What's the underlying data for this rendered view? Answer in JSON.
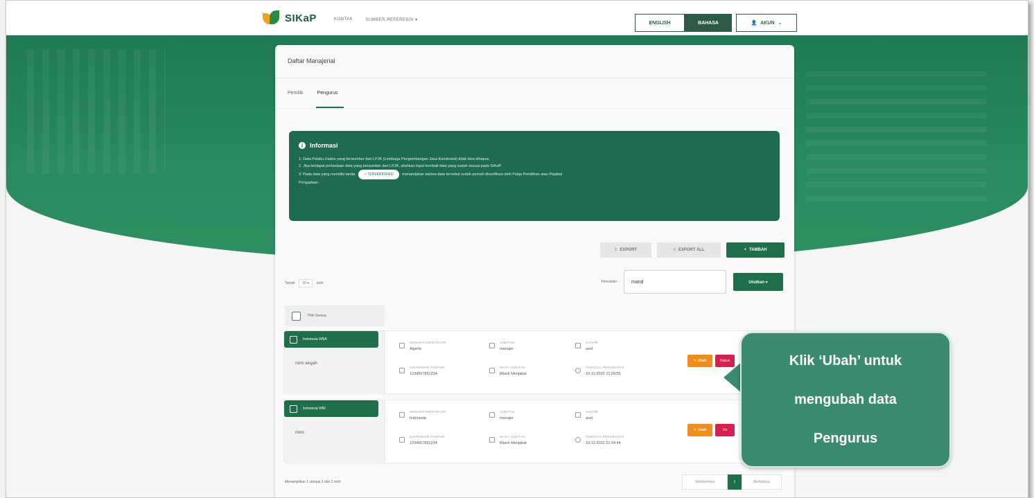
{
  "brand": {
    "logo_text": "SIKaP"
  },
  "nav": {
    "items": [
      "KONTAK",
      "SUMBER REFERENSI ▾"
    ]
  },
  "language": {
    "english": "ENGLISH",
    "bahasa": "BAHASA"
  },
  "account": {
    "label": "AKUN",
    "icon": "user-icon"
  },
  "page": {
    "title": "Daftar Manajerial",
    "tabs": [
      {
        "label": "Pemilik",
        "active": false
      },
      {
        "label": "Pengurus",
        "active": true
      }
    ]
  },
  "info": {
    "title": "Informasi",
    "lines": [
      "1. Data Pelaku Usaha yang bersumber dari LPJK (Lembaga Pengembangan Jasa Konstruksi) tidak bisa dihapus.",
      "2. Jika terdapat perbedaan data yang bersumber dari LPJK, silahkan input kembali data yang sudah sesuai pada SIKaP.",
      "3. Pada data yang memiliki tanda",
      "menandakan bahwa data tersebut sudah pernah diverifikasi oleh Pokja Pemilihan atau Pejabat",
      "Pengadaan."
    ],
    "verified_pill": "✓ TERVERIFIKASI"
  },
  "actions": {
    "export": "EXPORT",
    "export_all": "EXPORT ALL",
    "add": "TAMBAH"
  },
  "table_controls": {
    "show_prefix": "Tampil",
    "show_value": "10 ▾",
    "show_suffix": "entri",
    "search_label": "Pencarian",
    "search_value": "mand",
    "sort_label": "Urutkan ▾",
    "select_all": "Pilih Semua"
  },
  "rows": [
    {
      "status": "Indonesia WNA",
      "name": "mimi aisyah",
      "fields": {
        "citizenship_label": "KEWARGANEGARAAN",
        "citizenship": "Algeria",
        "position_label": "JABATAN",
        "position": "manajer",
        "share_label": "SAHAM",
        "share": "aset",
        "id_label": "NIK/NOMOR PASPOR",
        "id": "1234567891234",
        "tenure_label": "MASA JABATAN",
        "tenure": "Masih Menjabat",
        "updated_label": "TANGGAL PERUBAHAN",
        "updated": "10-11-2022 21:09:55"
      },
      "edit": "Ubah",
      "delete": "Hapus"
    },
    {
      "status": "Indonesia WNI",
      "name": "mimi",
      "fields": {
        "citizenship_label": "KEWARGANEGARAAN",
        "citizenship": "Indonesia",
        "position_label": "JABATAN",
        "position": "manajer",
        "share_label": "SAHAM",
        "share": "aset",
        "id_label": "NIK/NOMOR PASPOR",
        "id": "1234567891234",
        "tenure_label": "MASA JABATAN",
        "tenure": "Masih Menjabat",
        "updated_label": "TANGGAL PERUBAHAN",
        "updated": "10-11-2022 21:04:44"
      },
      "edit": "Ubah",
      "delete": "Ha"
    }
  ],
  "footer": {
    "summary": "Menampilkan 1 sampai 2 dari 2 entri",
    "prev": "Sebelumnya",
    "page": "1",
    "next": "Berikutnya"
  },
  "callout": {
    "line1": "Klik ‘Ubah’ untuk",
    "line2": "mengubah data",
    "line3": "Pengurus"
  },
  "colors": {
    "brand_green": "#1f6f4a",
    "edit_orange": "#ef8d1f",
    "delete_red": "#d3224f",
    "callout": "#3b8b73"
  }
}
